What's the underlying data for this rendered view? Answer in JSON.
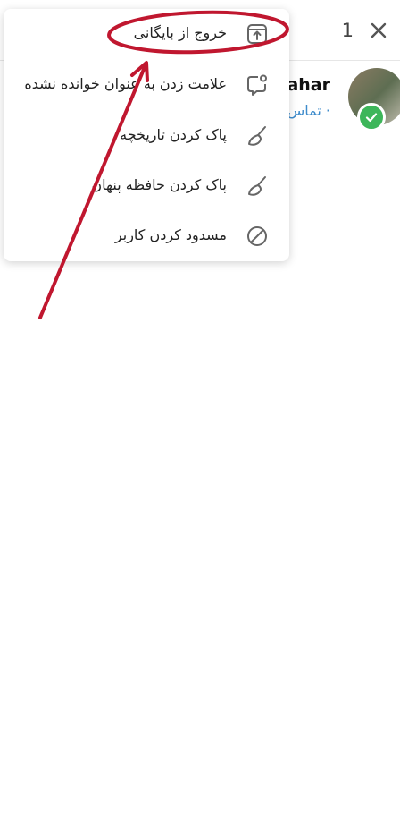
{
  "topbar": {
    "selected_count": "1",
    "close_icon": "close-icon"
  },
  "chat": {
    "name": "ahar",
    "subtitle": "تماس ·"
  },
  "menu": {
    "items": [
      {
        "label": "خروج از بایگانی",
        "icon": "unarchive-icon"
      },
      {
        "label": "علامت زدن به عنوان خوانده نشده",
        "icon": "mark-unread-icon"
      },
      {
        "label": "پاک کردن تاریخچه",
        "icon": "broom-icon"
      },
      {
        "label": "پاک کردن حافظه پنهان",
        "icon": "broom-icon"
      },
      {
        "label": "مسدود کردن کاربر",
        "icon": "block-icon"
      }
    ]
  },
  "colors": {
    "annotation": "#c0172f",
    "link": "#3f8ccc",
    "badge": "#3db65a"
  }
}
